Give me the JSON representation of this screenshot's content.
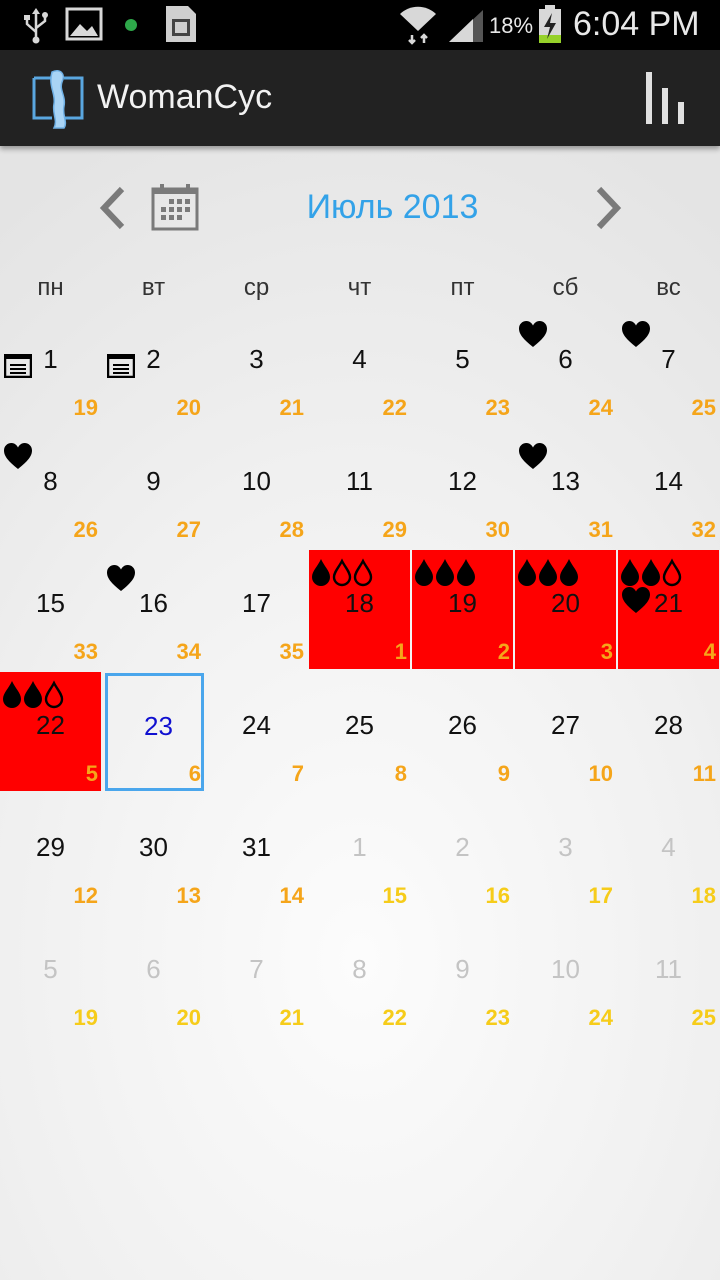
{
  "status_bar": {
    "battery": "18%",
    "time": "6:04 PM"
  },
  "app": {
    "title": "WomanCyc"
  },
  "nav": {
    "month_title": "Июль 2013"
  },
  "weekdays": [
    "пн",
    "вт",
    "ср",
    "чт",
    "пт",
    "сб",
    "вс"
  ],
  "colors": {
    "period": "#ff0000",
    "accent": "#33a2e8",
    "cycle_day": "#f5a51a",
    "cycle_day_next": "#f6cc1a",
    "today_border": "#4aa6ec"
  },
  "calendar": {
    "cells": [
      {
        "day": "1",
        "cycle": "19",
        "note": true
      },
      {
        "day": "2",
        "cycle": "20",
        "note": true
      },
      {
        "day": "3",
        "cycle": "21"
      },
      {
        "day": "4",
        "cycle": "22"
      },
      {
        "day": "5",
        "cycle": "23"
      },
      {
        "day": "6",
        "cycle": "24",
        "heart": true
      },
      {
        "day": "7",
        "cycle": "25",
        "heart": true
      },
      {
        "day": "8",
        "cycle": "26",
        "heart": true
      },
      {
        "day": "9",
        "cycle": "27"
      },
      {
        "day": "10",
        "cycle": "28"
      },
      {
        "day": "11",
        "cycle": "29"
      },
      {
        "day": "12",
        "cycle": "30"
      },
      {
        "day": "13",
        "cycle": "31",
        "heart": true
      },
      {
        "day": "14",
        "cycle": "32"
      },
      {
        "day": "15",
        "cycle": "33"
      },
      {
        "day": "16",
        "cycle": "34",
        "heart": true
      },
      {
        "day": "17",
        "cycle": "35"
      },
      {
        "day": "18",
        "cycle": "1",
        "period": true,
        "drops": [
          1,
          0,
          0
        ]
      },
      {
        "day": "19",
        "cycle": "2",
        "period": true,
        "drops": [
          1,
          1,
          1
        ]
      },
      {
        "day": "20",
        "cycle": "3",
        "period": true,
        "drops": [
          1,
          1,
          1
        ]
      },
      {
        "day": "21",
        "cycle": "4",
        "period": true,
        "drops": [
          1,
          1,
          0
        ],
        "heart": true
      },
      {
        "day": "22",
        "cycle": "5",
        "period": true,
        "drops": [
          1,
          1,
          0
        ]
      },
      {
        "day": "23",
        "cycle": "6",
        "today": true
      },
      {
        "day": "24",
        "cycle": "7"
      },
      {
        "day": "25",
        "cycle": "8"
      },
      {
        "day": "26",
        "cycle": "9"
      },
      {
        "day": "27",
        "cycle": "10"
      },
      {
        "day": "28",
        "cycle": "11"
      },
      {
        "day": "29",
        "cycle": "12"
      },
      {
        "day": "30",
        "cycle": "13"
      },
      {
        "day": "31",
        "cycle": "14"
      },
      {
        "day": "1",
        "cycle": "15",
        "other": true
      },
      {
        "day": "2",
        "cycle": "16",
        "other": true
      },
      {
        "day": "3",
        "cycle": "17",
        "other": true
      },
      {
        "day": "4",
        "cycle": "18",
        "other": true
      },
      {
        "day": "5",
        "cycle": "19",
        "other": true
      },
      {
        "day": "6",
        "cycle": "20",
        "other": true
      },
      {
        "day": "7",
        "cycle": "21",
        "other": true
      },
      {
        "day": "8",
        "cycle": "22",
        "other": true
      },
      {
        "day": "9",
        "cycle": "23",
        "other": true
      },
      {
        "day": "10",
        "cycle": "24",
        "other": true
      },
      {
        "day": "11",
        "cycle": "25",
        "other": true
      }
    ]
  }
}
